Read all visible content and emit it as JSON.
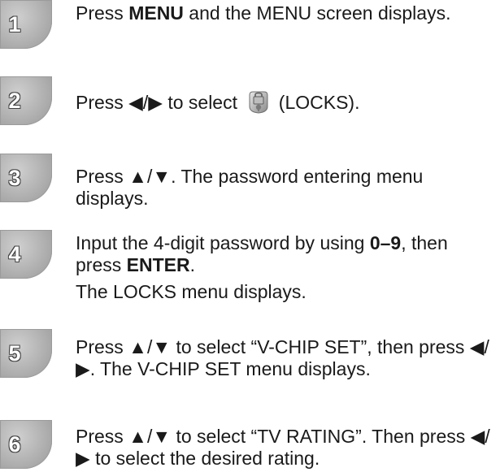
{
  "steps": [
    {
      "number": "1",
      "parts": [
        {
          "t": "Press "
        },
        {
          "b": "MENU"
        },
        {
          "t": " and the MENU screen displays."
        }
      ]
    },
    {
      "number": "2",
      "parts": [
        {
          "t": "Press ◀/▶ to select "
        },
        {
          "icon": "locks-icon"
        },
        {
          "t": " (LOCKS)."
        }
      ]
    },
    {
      "number": "3",
      "parts": [
        {
          "t": "Press ▲/▼. The password entering menu displays."
        }
      ]
    },
    {
      "number": "4",
      "parts": [
        {
          "t": "Input the 4-digit password by using "
        },
        {
          "b": "0–9"
        },
        {
          "t": ", then press "
        },
        {
          "b": "ENTER"
        },
        {
          "t": "."
        },
        {
          "br": true
        },
        {
          "t": "The LOCKS menu displays."
        }
      ]
    },
    {
      "number": "5",
      "parts": [
        {
          "t": "Press ▲/▼ to select “V-CHIP SET”, then press ◀/▶. The V-CHIP SET menu displays."
        }
      ]
    },
    {
      "number": "6",
      "parts": [
        {
          "t": "Press ▲/▼ to select “TV RATING”. Then press ◀/▶ to select the desired rating."
        }
      ]
    }
  ]
}
